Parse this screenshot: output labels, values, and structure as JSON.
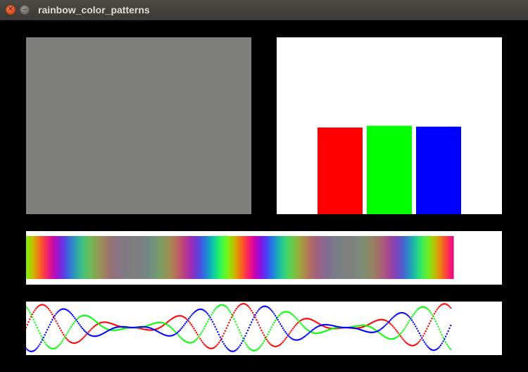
{
  "window": {
    "title": "rainbow_color_patterns",
    "close_icon": "close-icon",
    "minimize_icon": "minimize-icon"
  },
  "colors": {
    "gray_swatch": "#7f807e",
    "red": "#ff0000",
    "green": "#00ff00",
    "blue": "#0000ff"
  },
  "chart_data": [
    {
      "type": "bar",
      "categories": [
        "",
        "",
        ""
      ],
      "values": [
        0.49,
        0.5,
        0.495
      ],
      "colors": [
        "#ff0000",
        "#00ff00",
        "#0000ff"
      ],
      "ylim": [
        0,
        1
      ],
      "xlabel": "",
      "ylabel": "",
      "grid": false
    },
    {
      "type": "line",
      "x": [
        0,
        600
      ],
      "series": [
        {
          "color": "#ff0000",
          "phase_deg": 0
        },
        {
          "color": "#00ff00",
          "phase_deg": 120
        },
        {
          "color": "#0000ff",
          "phase_deg": 240
        }
      ],
      "ylim": [
        -1,
        1
      ],
      "xlabel": "",
      "ylabel": "",
      "grid": false
    }
  ]
}
